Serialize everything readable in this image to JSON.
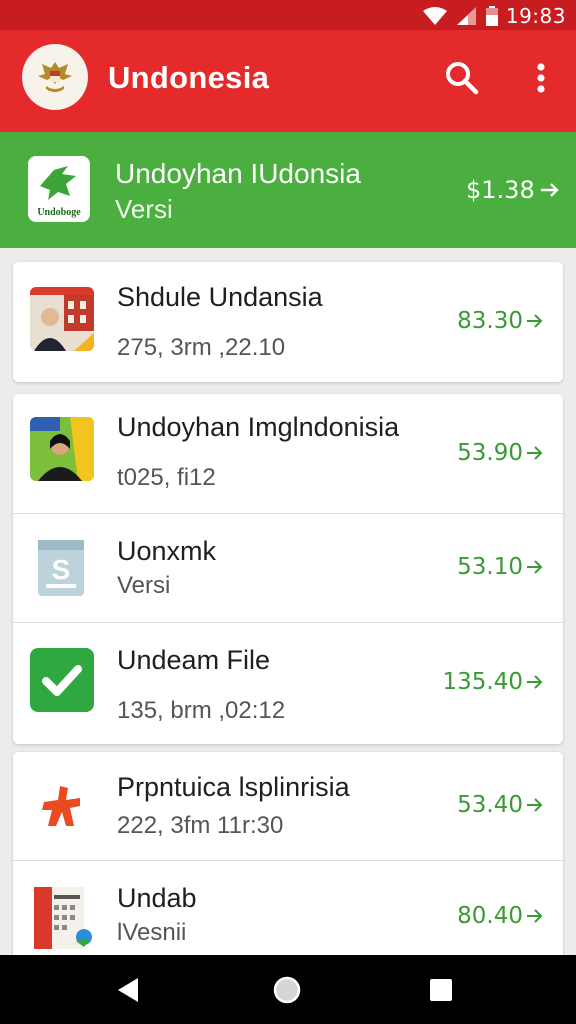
{
  "status_bar": {
    "time": "19:83"
  },
  "app_bar": {
    "title": "Undonesia",
    "search_icon": "search-icon",
    "more_icon": "more-vert-icon"
  },
  "featured": {
    "title": "Undoyhan IUdonsia",
    "subtitle": "Versi",
    "price": "$1.38",
    "icon_label": "Undoboge"
  },
  "apps": [
    {
      "title": "Shdule Undansia",
      "subtitle": "275, 3rm ,22.10",
      "price": "83.30"
    },
    {
      "title": "Undoyhan Imglndonisia",
      "subtitle": "t025, fi12",
      "price": "53.90"
    },
    {
      "title": "Uonxmk",
      "subtitle": "Versi",
      "price": "53.10",
      "icon_letter": "S"
    },
    {
      "title": "Undeam File",
      "subtitle": "135, brm ,02:12",
      "price": "135.40"
    },
    {
      "title": "Prpntuica lsplinrisia",
      "subtitle": "222, 3fm 11r:30",
      "price": "53.40"
    },
    {
      "title": "Undab",
      "subtitle": "lVesnii",
      "price": "80.40"
    }
  ],
  "colors": {
    "status_bar": "#c71d20",
    "app_bar": "#e42a2a",
    "featured_bg": "#4aaf3e",
    "price_green": "#3a9a35",
    "background": "#ececec"
  }
}
